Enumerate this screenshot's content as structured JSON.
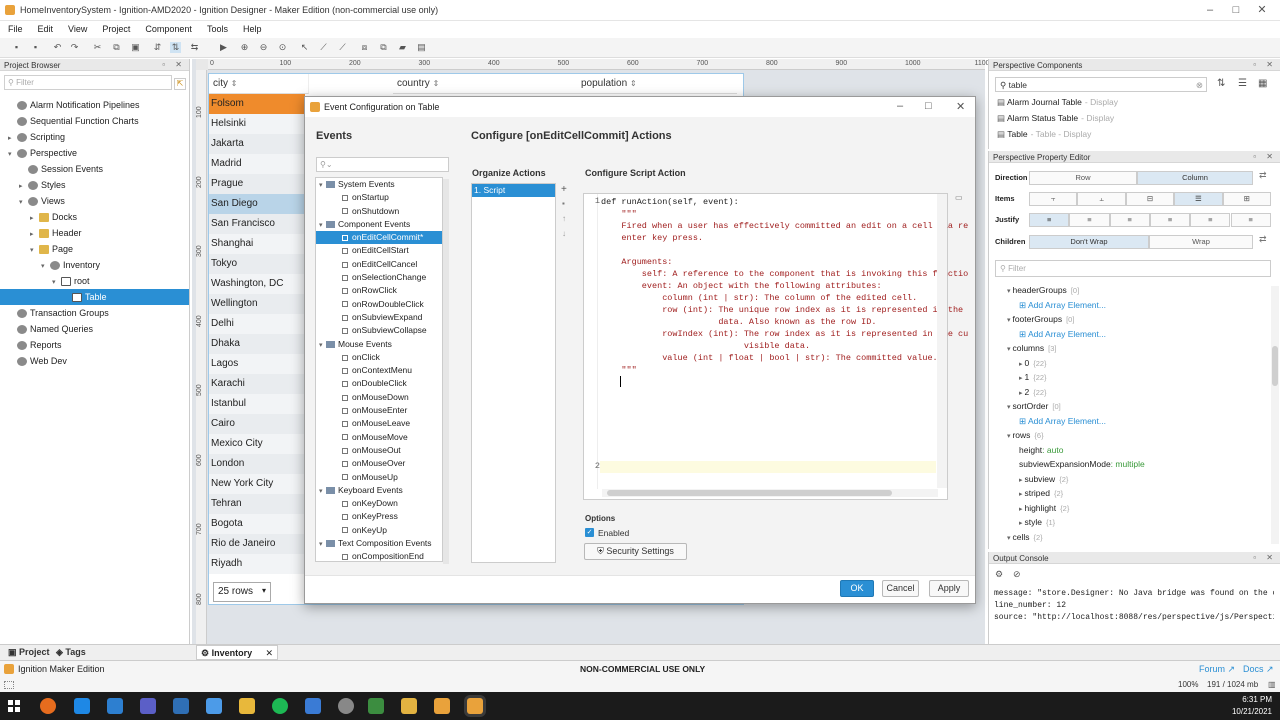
{
  "window": {
    "title": "HomeInventorySystem - Ignition-AMD2020 - Ignition Designer - Maker Edition (non-commercial use only)"
  },
  "menu": [
    "File",
    "Edit",
    "View",
    "Project",
    "Component",
    "Tools",
    "Help"
  ],
  "project_browser": {
    "title": "Project Browser",
    "filter_placeholder": "Filter",
    "items": [
      {
        "label": "Alarm Notification Pipelines",
        "indent": 0,
        "tog": "",
        "icon": "gear"
      },
      {
        "label": "Sequential Function Charts",
        "indent": 0,
        "tog": "",
        "icon": "gear"
      },
      {
        "label": "Scripting",
        "indent": 0,
        "tog": "▸",
        "icon": "gear"
      },
      {
        "label": "Perspective",
        "indent": 0,
        "tog": "▾",
        "icon": "gear"
      },
      {
        "label": "Session Events",
        "indent": 1,
        "tog": "",
        "icon": "gear"
      },
      {
        "label": "Styles",
        "indent": 1,
        "tog": "▸",
        "icon": "gear"
      },
      {
        "label": "Views",
        "indent": 1,
        "tog": "▾",
        "icon": "gear"
      },
      {
        "label": "Docks",
        "indent": 2,
        "tog": "▸",
        "icon": "folder"
      },
      {
        "label": "Header",
        "indent": 2,
        "tog": "▸",
        "icon": "folder"
      },
      {
        "label": "Page",
        "indent": 2,
        "tog": "▾",
        "icon": "folder"
      },
      {
        "label": "Inventory",
        "indent": 3,
        "tog": "▾",
        "icon": "gear"
      },
      {
        "label": "root",
        "indent": 4,
        "tog": "▾",
        "icon": "pagei"
      },
      {
        "label": "Table",
        "indent": 5,
        "tog": "",
        "icon": "pagei",
        "selected": true
      },
      {
        "label": "Transaction Groups",
        "indent": 0,
        "tog": "",
        "icon": "gear"
      },
      {
        "label": "Named Queries",
        "indent": 0,
        "tog": "",
        "icon": "gear"
      },
      {
        "label": "Reports",
        "indent": 0,
        "tog": "",
        "icon": "gear"
      },
      {
        "label": "Web Dev",
        "indent": 0,
        "tog": "",
        "icon": "gear"
      }
    ]
  },
  "ruler": {
    "top": [
      "0",
      "100",
      "200",
      "300",
      "400",
      "500",
      "600",
      "700",
      "800",
      "900",
      "1000",
      "1100"
    ],
    "left": [
      "100",
      "200",
      "300",
      "400",
      "500",
      "600",
      "700",
      "800"
    ]
  },
  "table": {
    "headers": [
      "city",
      "country",
      "population"
    ],
    "cities": [
      "Folsom",
      "Helsinki",
      "Jakarta",
      "Madrid",
      "Prague",
      "San Diego",
      "San Francisco",
      "Shanghai",
      "Tokyo",
      "Washington, DC",
      "Wellington",
      "Delhi",
      "Dhaka",
      "Lagos",
      "Karachi",
      "Istanbul",
      "Cairo",
      "Mexico City",
      "London",
      "New York City",
      "Tehran",
      "Bogota",
      "Rio de Janeiro",
      "Riyadh"
    ],
    "pager": "25 rows"
  },
  "dialog": {
    "title": "Event Configuration on Table",
    "events_title": "Events",
    "search_placeholder": "",
    "events": [
      {
        "label": "System Events",
        "cat": true
      },
      {
        "label": "onStartup"
      },
      {
        "label": "onShutdown"
      },
      {
        "label": "Component Events",
        "cat": true
      },
      {
        "label": "onEditCellCommit*",
        "selected": true
      },
      {
        "label": "onEditCellStart"
      },
      {
        "label": "onEditCellCancel"
      },
      {
        "label": "onSelectionChange"
      },
      {
        "label": "onRowClick"
      },
      {
        "label": "onRowDoubleClick"
      },
      {
        "label": "onSubviewExpand"
      },
      {
        "label": "onSubviewCollapse"
      },
      {
        "label": "Mouse Events",
        "cat": true
      },
      {
        "label": "onClick"
      },
      {
        "label": "onContextMenu"
      },
      {
        "label": "onDoubleClick"
      },
      {
        "label": "onMouseDown"
      },
      {
        "label": "onMouseEnter"
      },
      {
        "label": "onMouseLeave"
      },
      {
        "label": "onMouseMove"
      },
      {
        "label": "onMouseOut"
      },
      {
        "label": "onMouseOver"
      },
      {
        "label": "onMouseUp"
      },
      {
        "label": "Keyboard Events",
        "cat": true
      },
      {
        "label": "onKeyDown"
      },
      {
        "label": "onKeyPress"
      },
      {
        "label": "onKeyUp"
      },
      {
        "label": "Text Composition Events",
        "cat": true
      },
      {
        "label": "onCompositionEnd"
      }
    ],
    "configure_title": "Configure [onEditCellCommit] Actions",
    "organize_title": "Organize Actions",
    "action_item": "1. Script",
    "script_title": "Configure Script Action",
    "code": [
      {
        "n": "1",
        "t": "def runAction(self, event):"
      },
      {
        "n": "",
        "t": "    \"\"\""
      },
      {
        "n": "",
        "t": "    Fired when a user has effectively committed an edit on a cell via re"
      },
      {
        "n": "",
        "t": "    enter key press."
      },
      {
        "n": "",
        "t": ""
      },
      {
        "n": "",
        "t": "    Arguments:"
      },
      {
        "n": "",
        "t": "        self: A reference to the component that is invoking this functio"
      },
      {
        "n": "",
        "t": "        event: An object with the following attributes:"
      },
      {
        "n": "",
        "t": "            column (int | str): The column of the edited cell."
      },
      {
        "n": "",
        "t": "            row (int): The unique row index as it is represented in the"
      },
      {
        "n": "",
        "t": "                       data. Also known as the row ID."
      },
      {
        "n": "",
        "t": "            rowIndex (int): The row index as it is represented in the cu"
      },
      {
        "n": "",
        "t": "                            visible data."
      },
      {
        "n": "",
        "t": "            value (int | float | bool | str): The committed value."
      },
      {
        "n": "",
        "t": "    \"\"\""
      },
      {
        "n": "2",
        "t": "    "
      }
    ],
    "options_title": "Options",
    "enabled_label": "Enabled",
    "security_label": "Security Settings",
    "ok": "OK",
    "cancel": "Cancel",
    "apply": "Apply"
  },
  "components_panel": {
    "title": "Perspective Components",
    "search": "table",
    "items": [
      {
        "name": "Alarm Journal Table",
        "cat": "- Display"
      },
      {
        "name": "Alarm Status Table",
        "cat": "- Display"
      },
      {
        "name": "Table",
        "cat": "- Table - Display"
      }
    ]
  },
  "property_editor": {
    "title": "Perspective Property Editor",
    "direction_label": "Direction",
    "row": "Row",
    "column": "Column",
    "items_label": "Items",
    "justify_label": "Justify",
    "children_label": "Children",
    "dont_wrap": "Don't Wrap",
    "wrap": "Wrap",
    "filter_placeholder": "Filter",
    "props": [
      {
        "name": "headerGroups",
        "count": "[0]",
        "lvl": 0,
        "tog": "▾"
      },
      {
        "name": "Add Array Element...",
        "lvl": 1,
        "link": true
      },
      {
        "name": "footerGroups",
        "count": "[0]",
        "lvl": 0,
        "tog": "▾"
      },
      {
        "name": "Add Array Element...",
        "lvl": 1,
        "link": true
      },
      {
        "name": "columns",
        "count": "[3]",
        "lvl": 0,
        "tog": "▾"
      },
      {
        "name": "0",
        "count": "{22}",
        "lvl": 1,
        "tog": "▸"
      },
      {
        "name": "1",
        "count": "{22}",
        "lvl": 1,
        "tog": "▸"
      },
      {
        "name": "2",
        "count": "{22}",
        "lvl": 1,
        "tog": "▸"
      },
      {
        "name": "sortOrder",
        "count": "[0]",
        "lvl": 0,
        "tog": "▾"
      },
      {
        "name": "Add Array Element...",
        "lvl": 1,
        "link": true
      },
      {
        "name": "rows",
        "count": "{6}",
        "lvl": 0,
        "tog": "▾"
      },
      {
        "name": "height",
        "value": ": auto",
        "lvl": 1
      },
      {
        "name": "subviewExpansionMode",
        "value": ": multiple",
        "lvl": 1
      },
      {
        "name": "subview",
        "count": "{2}",
        "lvl": 1,
        "tog": "▸"
      },
      {
        "name": "striped",
        "count": "{2}",
        "lvl": 1,
        "tog": "▸"
      },
      {
        "name": "highlight",
        "count": "{2}",
        "lvl": 1,
        "tog": "▸"
      },
      {
        "name": "style",
        "count": "{1}",
        "lvl": 1,
        "tog": "▸"
      },
      {
        "name": "cells",
        "count": "{2}",
        "lvl": 0,
        "tog": "▾"
      }
    ]
  },
  "output_console": {
    "title": "Output Console",
    "lines": [
      "message: \"store.Designer: No Java bridge was found on the c",
      "line_number: 12",
      "source: \"http://localhost:8088/res/perspective/js/Perspecti"
    ]
  },
  "bottom_tabs": {
    "project": "Project",
    "tags": "Tags",
    "inventory": "Inventory"
  },
  "status": {
    "edition": "Ignition Maker Edition",
    "notice": "NON-COMMERCIAL USE ONLY",
    "forum": "Forum",
    "docs": "Docs",
    "zoom": "100%",
    "memory": "191 / 1024 mb"
  },
  "taskbar": {
    "time": "6:31 PM",
    "date": "10/21/2021"
  },
  "colors": {
    "accent": "#2a8fd4",
    "folsom": "#ef8b2c",
    "code": "#a01f1f"
  }
}
